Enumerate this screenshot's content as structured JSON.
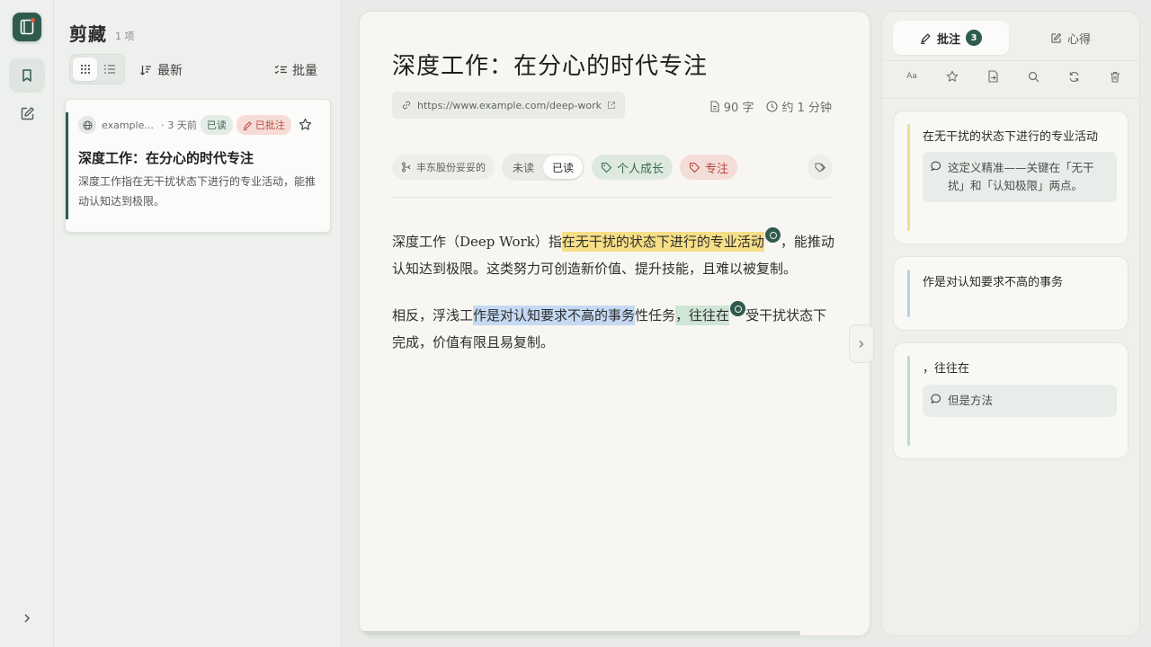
{
  "app": {
    "brand_color": "#2f5b4e"
  },
  "rail": {
    "items": [
      {
        "icon": "bookmark-icon",
        "active": true
      },
      {
        "icon": "edit-note-icon",
        "active": false
      }
    ]
  },
  "list": {
    "title": "剪藏",
    "count": "1 项",
    "sort_label": "最新",
    "batch_label": "批量",
    "card": {
      "domain": "example...",
      "separator": "·",
      "time": "3 天前",
      "read_badge": "已读",
      "annotated_badge": "已批注",
      "title": "深度工作：在分心的时代专注",
      "description": "深度工作指在无干扰状态下进行的专业活动，能推动认知达到极限。"
    }
  },
  "reader": {
    "title": "深度工作：在分心的时代专注",
    "url": "https://www.example.com/deep-work",
    "word_count": "90 字",
    "read_time": "约 1 分钟",
    "source": "丰东股份妥妥的",
    "status": {
      "unread": "未读",
      "read": "已读",
      "selected": "已读"
    },
    "tags": [
      "个人成长",
      "专注"
    ],
    "paragraphs": [
      {
        "pre": "深度工作（Deep Work）指",
        "hl1": "在无干扰的状态下进行的专业活动",
        "post": "，能推动认知达到极限。这类努力可创造新价值、提升技能，且难以被复制。"
      },
      {
        "pre": "相反，浮浅工",
        "hl1": "作是对认知要求不高的事务",
        "mid": "性任务",
        "hl2": "，往往在",
        "post": "受干扰状态下完成，价值有限且易复制。"
      }
    ]
  },
  "side": {
    "tab_annotations": "批注",
    "annotation_count": "3",
    "tab_notes": "心得",
    "tools": [
      "font-size-icon",
      "star-icon",
      "export-icon",
      "search-icon",
      "refresh-icon",
      "trash-icon"
    ],
    "annotations": [
      {
        "quote": "在无干扰的状态下进行的专业活动",
        "color": "#ece08a",
        "note": "这定义精准——关键在「无干扰」和「认知极限」两点。"
      },
      {
        "quote": "作是对认知要求不高的事务",
        "color": "#b9d0ea"
      },
      {
        "quote": "，往往在",
        "color": "#bcdcc5",
        "note": "但是方法"
      }
    ]
  }
}
